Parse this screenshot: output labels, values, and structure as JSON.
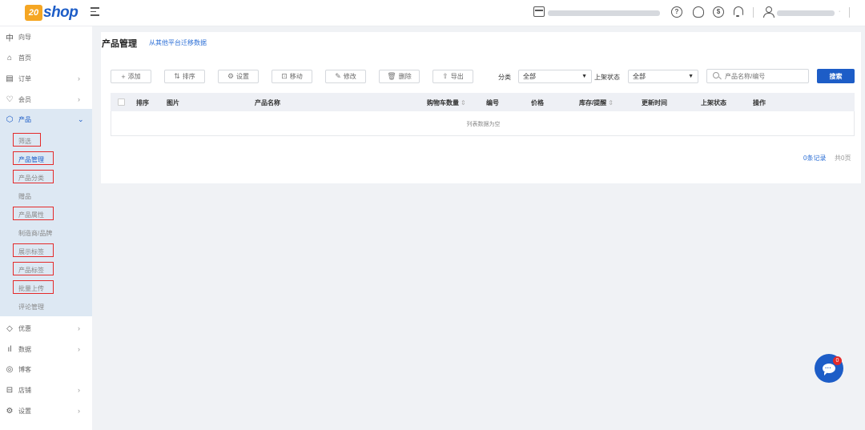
{
  "header": {
    "logo_badge": "20",
    "logo_text": "shop",
    "help_glyph": "?",
    "coin_glyph": "$"
  },
  "sidebar": {
    "items": [
      {
        "label": "向导",
        "icon": "guide-icon",
        "glyph": "中",
        "arrow": ""
      },
      {
        "label": "首页",
        "icon": "home-icon",
        "glyph": "⌂",
        "arrow": ""
      },
      {
        "label": "订单",
        "icon": "order-icon",
        "glyph": "▤",
        "arrow": "›"
      },
      {
        "label": "会员",
        "icon": "member-icon",
        "glyph": "♡",
        "arrow": "›"
      },
      {
        "label": "产品",
        "icon": "product-icon",
        "glyph": "⬡",
        "arrow": "⌄"
      },
      {
        "label": "优惠",
        "icon": "discount-icon",
        "glyph": "◇",
        "arrow": "›"
      },
      {
        "label": "数据",
        "icon": "data-icon",
        "glyph": "ıl",
        "arrow": "›"
      },
      {
        "label": "博客",
        "icon": "blog-icon",
        "glyph": "◎",
        "arrow": ""
      },
      {
        "label": "店铺",
        "icon": "store-icon",
        "glyph": "⊟",
        "arrow": "›"
      },
      {
        "label": "设置",
        "icon": "settings-icon",
        "glyph": "⚙",
        "arrow": "›"
      }
    ],
    "submenu": [
      {
        "label": "筛选"
      },
      {
        "label": "产品管理"
      },
      {
        "label": "产品分类"
      },
      {
        "label": "赠品"
      },
      {
        "label": "产品属性"
      },
      {
        "label": "制造商/品牌"
      },
      {
        "label": "展示标签"
      },
      {
        "label": "产品标签"
      },
      {
        "label": "批量上传"
      },
      {
        "label": "评论管理"
      }
    ]
  },
  "main": {
    "title": "产品管理",
    "migrate_link": "从其他平台迁移数据",
    "toolbar": {
      "add": "添加",
      "add_glyph": "+",
      "sort": "排序",
      "sort_glyph": "⇅",
      "settings": "设置",
      "settings_glyph": "⚙",
      "move": "移动",
      "move_glyph": "⊡",
      "edit": "修改",
      "edit_glyph": "✎",
      "delete": "删除",
      "delete_glyph": "🗑",
      "export": "导出",
      "export_glyph": "⇧"
    },
    "filters": {
      "category_label": "分类",
      "category_value": "全部",
      "status_label": "上架状态",
      "status_value": "全部",
      "search_placeholder": "产品名称/编号",
      "search_button": "搜索"
    },
    "table": {
      "columns": [
        "排序",
        "图片",
        "产品名称",
        "购物车数量",
        "编号",
        "价格",
        "库存/提醒",
        "更新时间",
        "上架状态",
        "操作"
      ],
      "sort_glyph": "⇕",
      "empty": "列表数据为空"
    },
    "pagination": {
      "records": "0条记录",
      "pages": "共0页"
    }
  },
  "chat": {
    "badge": "0"
  },
  "colors": {
    "accent": "#1d5dc7",
    "highlight_box": "#e42a2a",
    "active_bg": "#dde8f3"
  }
}
